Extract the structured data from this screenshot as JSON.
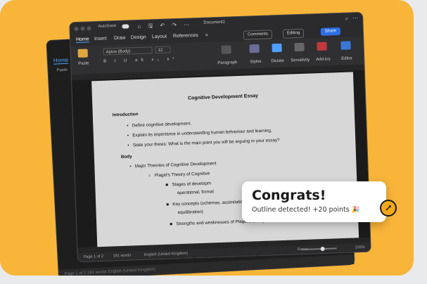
{
  "window": {
    "autosave_label": "AutoSave",
    "title": "Document1",
    "toolbar_icons": "⌂ 🖫 ↶ ↷ ⋯",
    "search_icon": "⌕",
    "more_icon": "⋯"
  },
  "tabs": [
    "Home",
    "Insert",
    "Draw",
    "Design",
    "Layout",
    "References",
    "»"
  ],
  "header_buttons": {
    "comments": "Comments",
    "editing": "Editing",
    "share": "Share"
  },
  "ribbon": {
    "paste_label": "Paste",
    "font": "Aptos (Body)",
    "size": "12",
    "format_glyphs": "B I U ab x₂ x²",
    "paragraph_label": "Paragraph",
    "styles_label": "Styles",
    "dictate_label": "Dictate",
    "sensitivity_label": "Sensitivity",
    "addins_label": "Add-ins",
    "editor_label": "Editor"
  },
  "document": {
    "title": "Cognitive Development Essay",
    "lines": [
      {
        "text": "Introduction",
        "style": "heading"
      },
      {
        "text": "Define cognitive development.",
        "style": "bullet1"
      },
      {
        "text": "Explain its importance in understanding human behaviour and learning.",
        "style": "bullet1"
      },
      {
        "text": "State your thesis: What is the main point you will be arguing in your essay?",
        "style": "bullet1"
      },
      {
        "text": "Body",
        "style": "heading"
      },
      {
        "text": "Major Theories of Cognitive Development",
        "style": "bullet1"
      },
      {
        "text": "Piaget's Theory of Cognitive",
        "style": "bullet2"
      },
      {
        "text": "Stages of developm",
        "style": "bullet3"
      },
      {
        "text": "operational, formal",
        "style": "cont3"
      },
      {
        "text": "Key concepts (schemas, assimilation, accommodation,",
        "style": "bullet3"
      },
      {
        "text": "equilibration)",
        "style": "cont3"
      },
      {
        "text": "Strengths and weaknesses of Piaget's theory",
        "style": "bullet3"
      }
    ]
  },
  "statusbar": {
    "page": "Page 1 of 2",
    "words": "181 words",
    "language": "English (United Kingdom)",
    "focus": "Focus",
    "zoom": "126%",
    "zoom_level": 0.6
  },
  "back_window": {
    "home_tab": "Home",
    "paste_label": "Paste",
    "footer": "Page 1 of 2   181 words   English (United Kingdom)",
    "peek_line": "Strengths and weaknesses of Piaget's theory"
  },
  "toast": {
    "heading": "Congrats!",
    "message": "Outline detected! +20 points 🎉"
  },
  "badge_icon": "rocket-icon",
  "colors": {
    "background": "#f8b53a",
    "accent": "#2f6fe4",
    "badge": "#f6a81c"
  }
}
